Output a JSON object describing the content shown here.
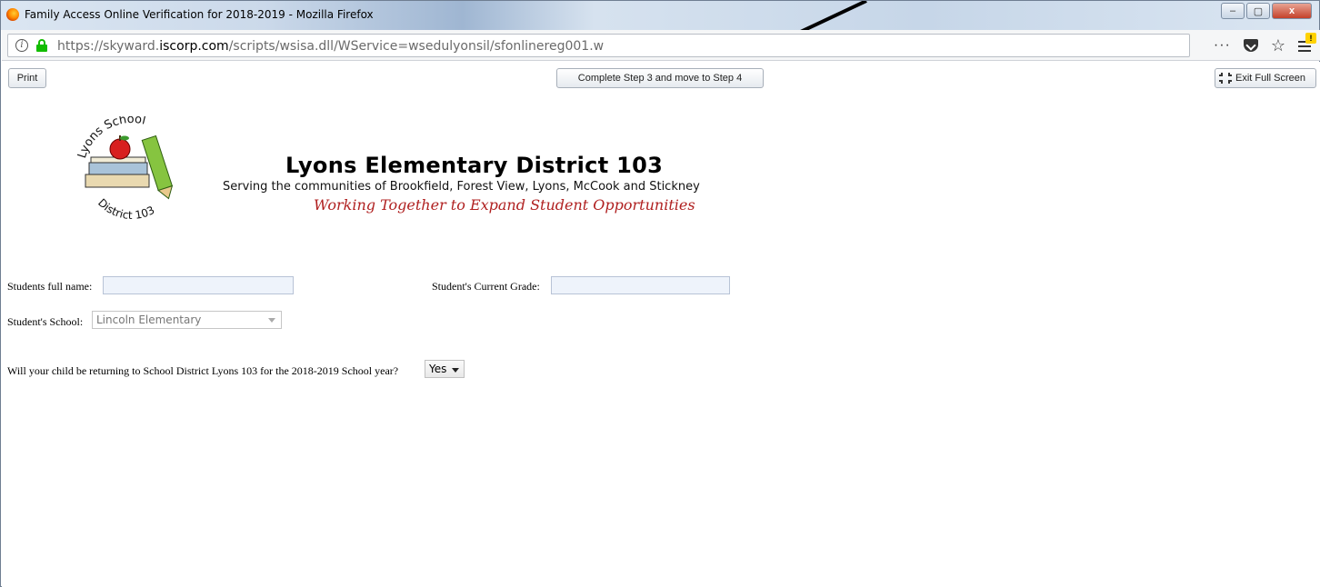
{
  "window": {
    "title": "Family Access Online Verification for 2018-2019 - Mozilla Firefox",
    "controls": {
      "minimize": "–",
      "maximize": "▢",
      "close": "x"
    }
  },
  "browser": {
    "url_prefix": "https://skyward.",
    "url_host": "iscorp.com",
    "url_path": "/scripts/wsisa.dll/WService=wsedulyonsil/sfonlinereg001.w",
    "more_icon": "···",
    "star_icon": "☆",
    "menu_badge": "!"
  },
  "toolbar": {
    "print_label": "Print",
    "step_label": "Complete Step 3 and move to Step 4",
    "exit_fullscreen_label": "Exit Full Screen"
  },
  "header": {
    "logo_top_text": "Lyons School",
    "logo_bottom_text": "District 103",
    "title": "Lyons Elementary District 103",
    "subtitle": "Serving the communities of Brookfield, Forest View, Lyons, McCook and Stickney",
    "motto": "Working Together to Expand Student Opportunities"
  },
  "form": {
    "full_name_label": "Students full name:",
    "full_name_value": "",
    "grade_label": "Student's Current Grade:",
    "grade_value": "",
    "school_label": "Student's School:",
    "school_value": "Lincoln Elementary",
    "returning_question": "Will your child be returning to School District Lyons 103 for the 2018-2019 School year?",
    "returning_value": "Yes"
  },
  "colors": {
    "motto": "#b02020",
    "field_bg": "#eef3fb",
    "lock": "#12bc00"
  }
}
